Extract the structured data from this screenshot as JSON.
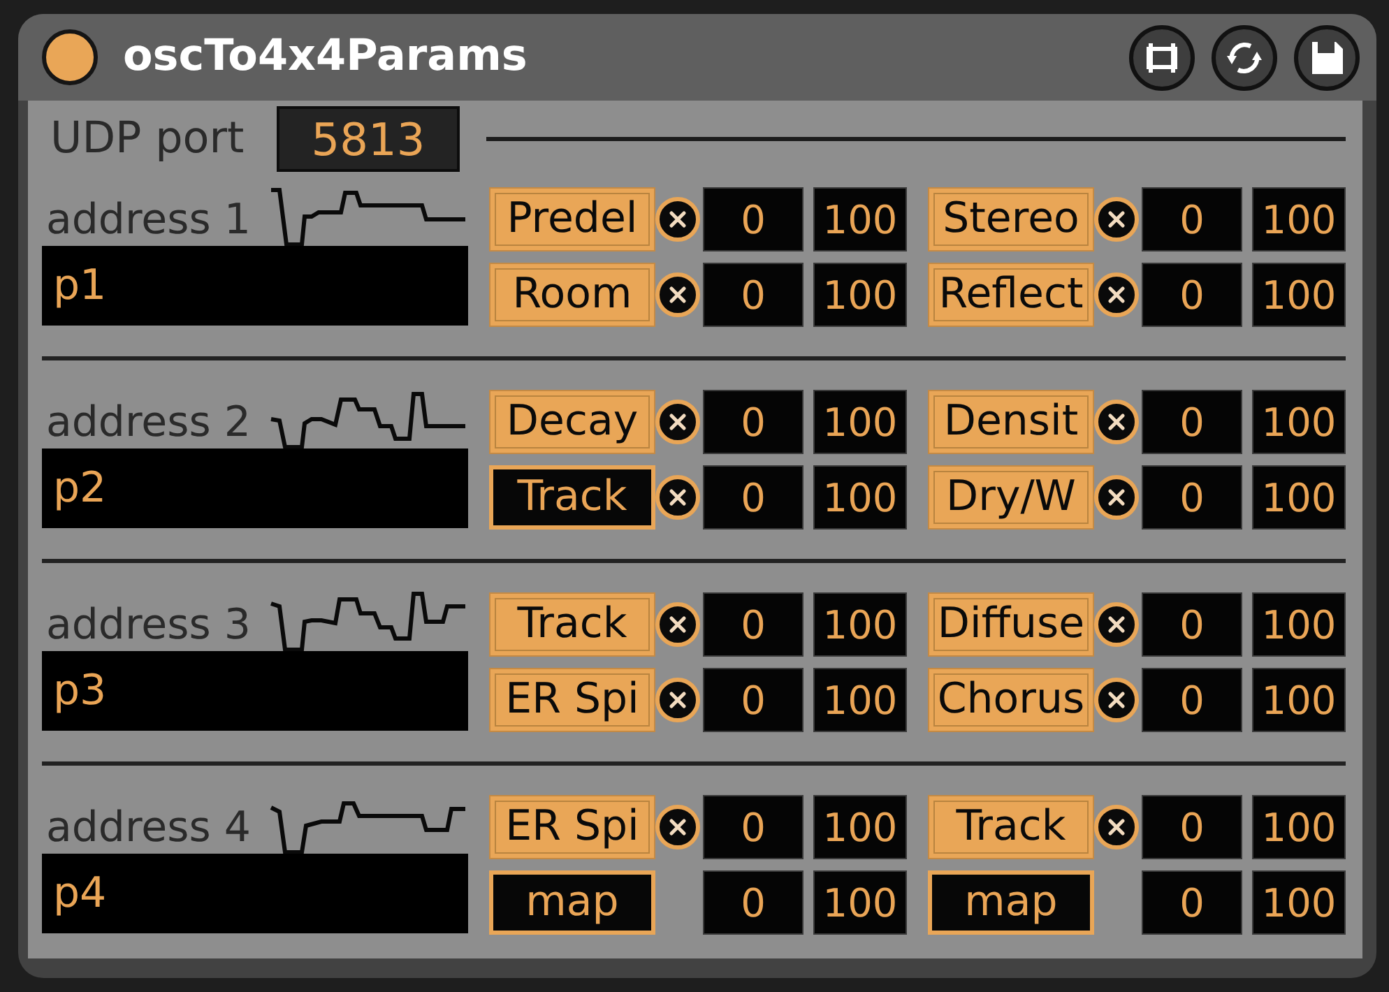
{
  "window": {
    "title": "oscTo4x4Params",
    "on": true
  },
  "port": {
    "label": "UDP port",
    "value": "5813"
  },
  "sections": [
    {
      "label": "address 1",
      "address": "p1",
      "params": [
        {
          "kind": "mapped",
          "label": "Predel",
          "on": true,
          "min": "0",
          "max": "100"
        },
        {
          "kind": "mapped",
          "label": "Stereo",
          "on": true,
          "min": "0",
          "max": "100"
        },
        {
          "kind": "mapped",
          "label": "Room",
          "on": true,
          "min": "0",
          "max": "100"
        },
        {
          "kind": "mapped",
          "label": "Reflect",
          "on": true,
          "min": "0",
          "max": "100"
        }
      ]
    },
    {
      "label": "address 2",
      "address": "p2",
      "params": [
        {
          "kind": "mapped",
          "label": "Decay",
          "on": true,
          "min": "0",
          "max": "100"
        },
        {
          "kind": "mapped",
          "label": "Densit",
          "on": true,
          "min": "0",
          "max": "100"
        },
        {
          "kind": "mapped",
          "label": "Track",
          "on": false,
          "min": "0",
          "max": "100"
        },
        {
          "kind": "mapped",
          "label": "Dry/W",
          "on": true,
          "min": "0",
          "max": "100"
        }
      ]
    },
    {
      "label": "address 3",
      "address": "p3",
      "params": [
        {
          "kind": "mapped",
          "label": "Track",
          "on": true,
          "min": "0",
          "max": "100"
        },
        {
          "kind": "mapped",
          "label": "Diffuse",
          "on": true,
          "min": "0",
          "max": "100"
        },
        {
          "kind": "mapped",
          "label": "ER Spi",
          "on": true,
          "min": "0",
          "max": "100"
        },
        {
          "kind": "mapped",
          "label": "Chorus",
          "on": true,
          "min": "0",
          "max": "100"
        }
      ]
    },
    {
      "label": "address 4",
      "address": "p4",
      "params": [
        {
          "kind": "mapped",
          "label": "ER Spi",
          "on": true,
          "min": "0",
          "max": "100"
        },
        {
          "kind": "mapped",
          "label": "Track",
          "on": true,
          "min": "0",
          "max": "100"
        },
        {
          "kind": "unmapped",
          "label": "map",
          "on": false,
          "min": "0",
          "max": "100"
        },
        {
          "kind": "unmapped",
          "label": "map",
          "on": false,
          "min": "0",
          "max": "100"
        }
      ]
    }
  ]
}
